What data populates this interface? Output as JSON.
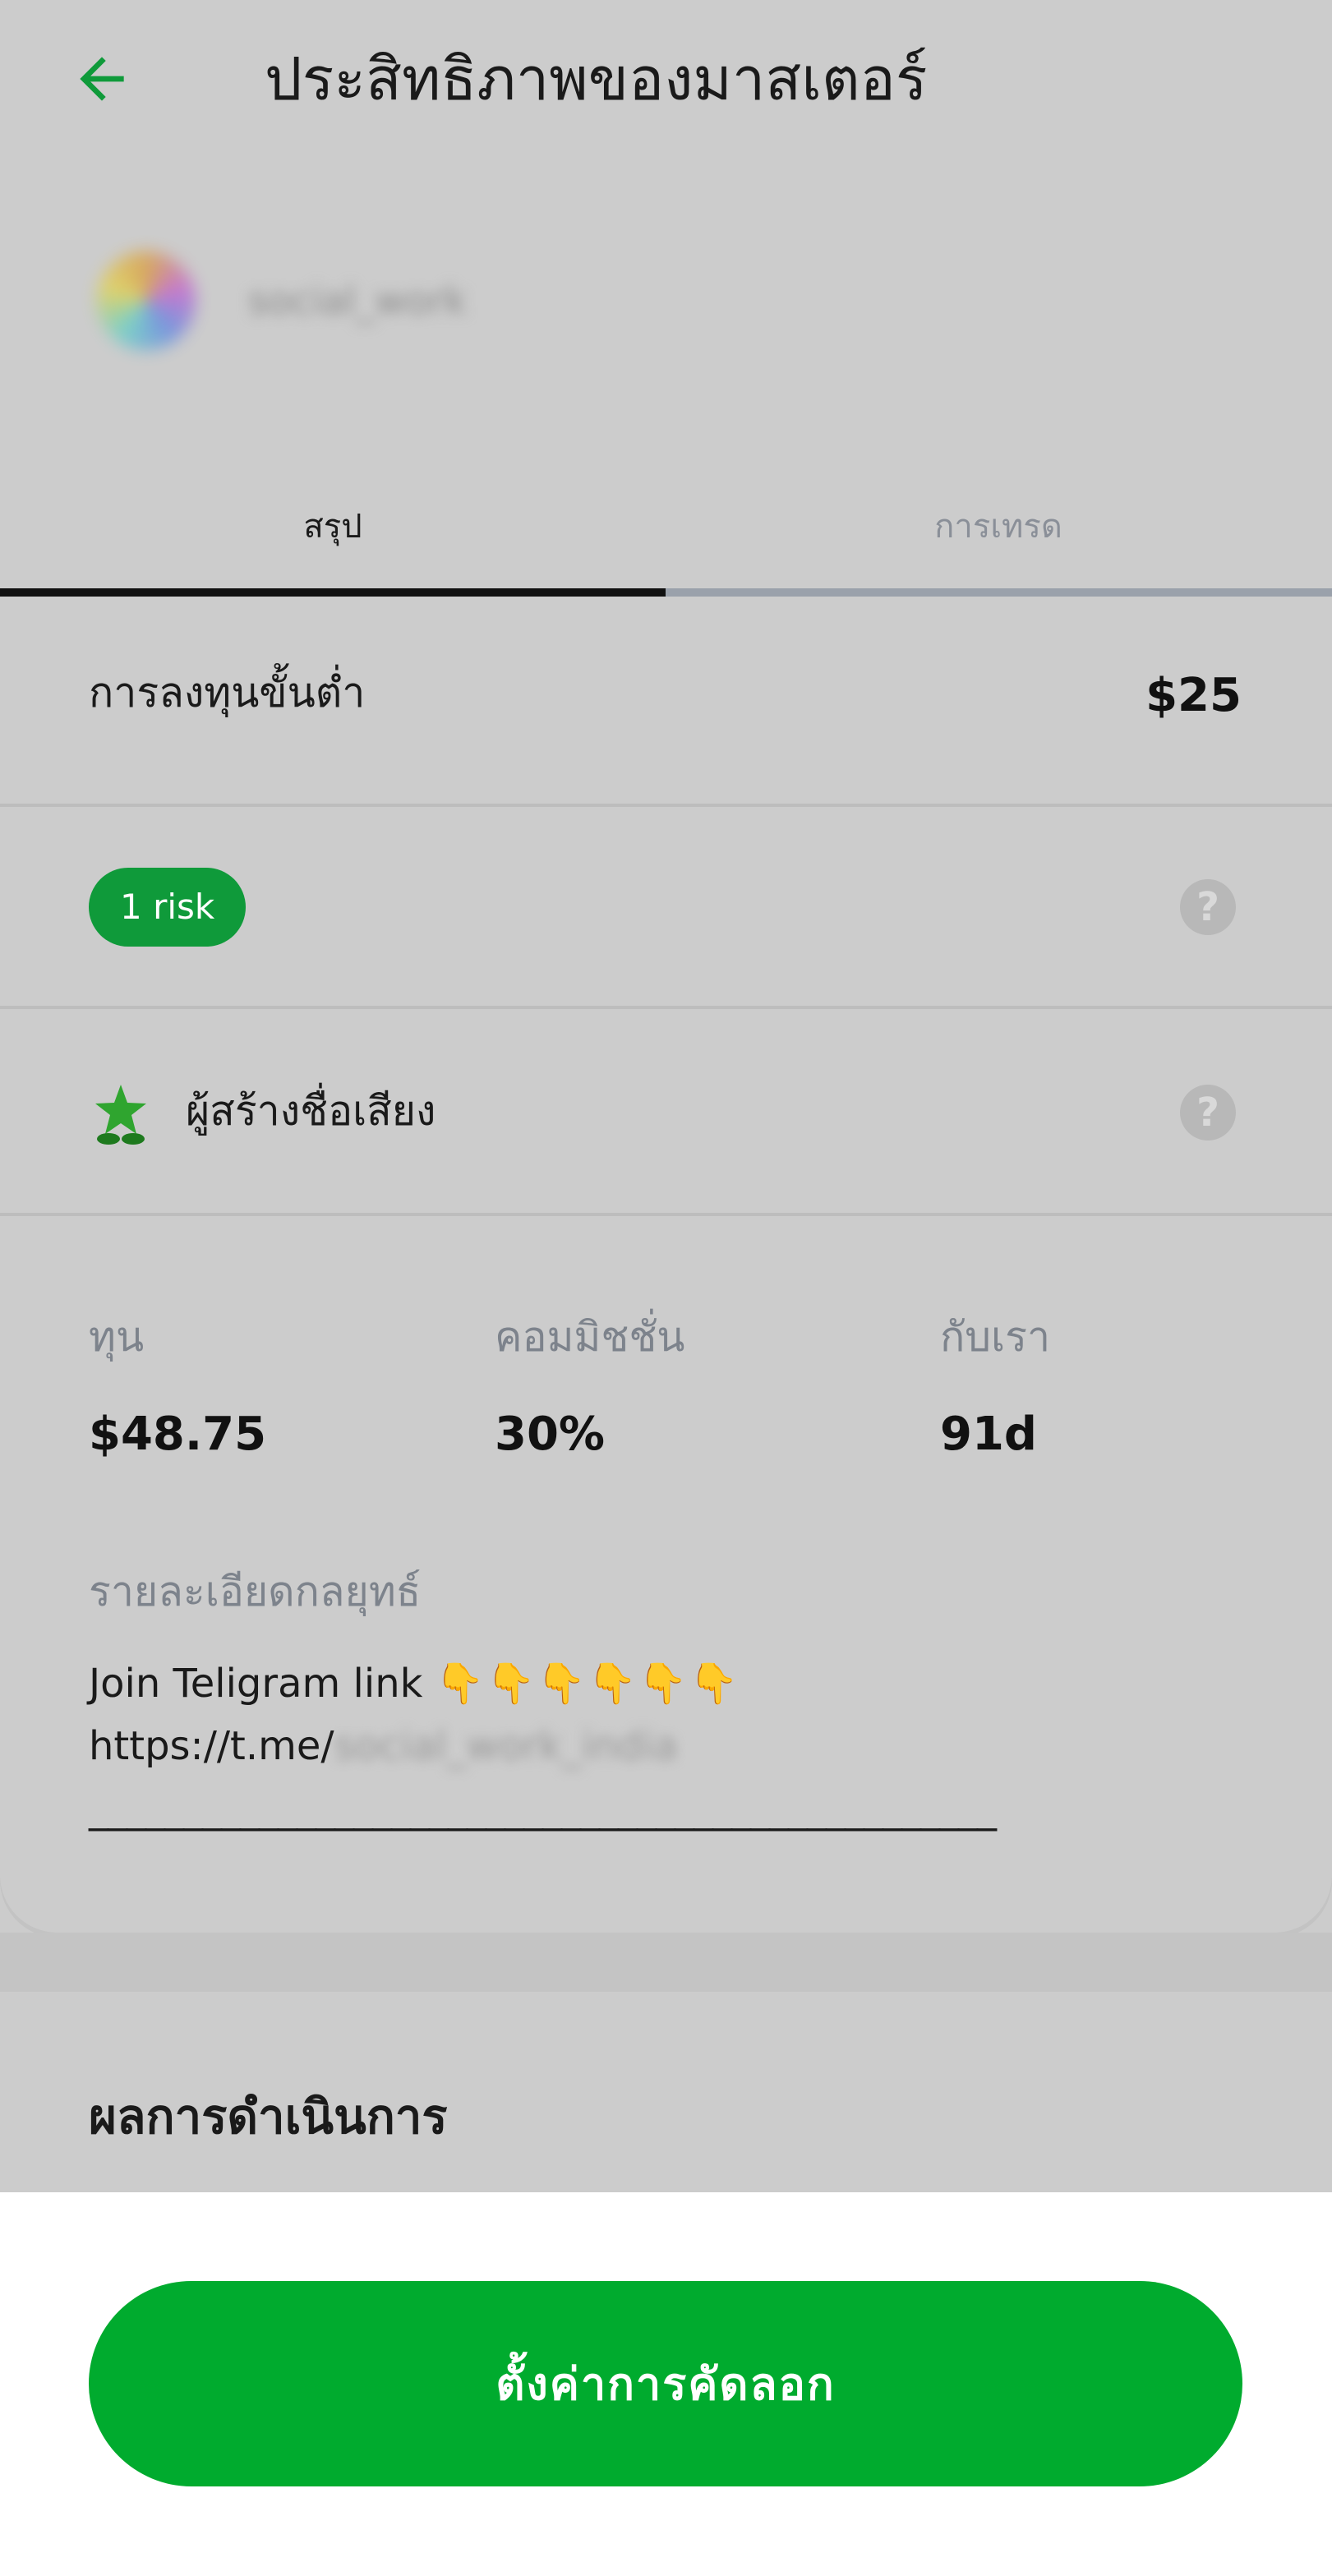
{
  "header": {
    "title": "ประสิทธิภาพของมาสเตอร์"
  },
  "profile": {
    "name": "social_work"
  },
  "tabs": [
    {
      "label": "สรุป",
      "active": true
    },
    {
      "label": "การเทรด",
      "active": false
    }
  ],
  "summary": {
    "min_investment_label": "การลงทุนขั้นต่ำ",
    "min_investment_value": "$25",
    "risk_badge": "1 risk",
    "creator_label": "ผู้สร้างชื่อเสียง",
    "help_symbol": "?",
    "stats": [
      {
        "label": "ทุน",
        "value": "$48.75"
      },
      {
        "label": "คอมมิชชั่น",
        "value": "30%"
      },
      {
        "label": "กับเรา",
        "value": "91d"
      }
    ],
    "strategy": {
      "label": "รายละเอียดกลยุทธ์",
      "line1_text": "Join Teligram link",
      "line1_emoji": "👇👇👇👇👇👇",
      "line2_prefix": "https://t.me/",
      "line2_handle": "social_work_india",
      "line3": "________________________________________________"
    }
  },
  "performance": {
    "title": "ผลการดำเนินการ"
  },
  "cta": {
    "label": "ตั้งค่าการคัดลอก"
  },
  "colors": {
    "accent_green": "#00ab2e",
    "badge_green": "#0f9a3a",
    "back_arrow": "#0f9a3a",
    "star": "#2fa52f"
  },
  "icons": {
    "back": "arrow-left-icon",
    "help": "question-circle-icon",
    "creator": "star-sprout-icon"
  }
}
